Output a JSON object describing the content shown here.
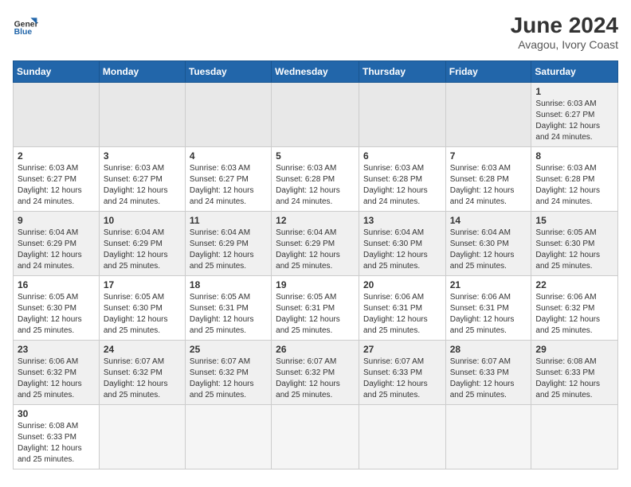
{
  "header": {
    "logo_text_normal": "General",
    "logo_text_bold": "Blue",
    "main_title": "June 2024",
    "subtitle": "Avagou, Ivory Coast"
  },
  "calendar": {
    "days_of_week": [
      "Sunday",
      "Monday",
      "Tuesday",
      "Wednesday",
      "Thursday",
      "Friday",
      "Saturday"
    ],
    "weeks": [
      [
        {
          "day": "",
          "info": ""
        },
        {
          "day": "",
          "info": ""
        },
        {
          "day": "",
          "info": ""
        },
        {
          "day": "",
          "info": ""
        },
        {
          "day": "",
          "info": ""
        },
        {
          "day": "",
          "info": ""
        },
        {
          "day": "1",
          "info": "Sunrise: 6:03 AM\nSunset: 6:27 PM\nDaylight: 12 hours and 24 minutes."
        }
      ],
      [
        {
          "day": "2",
          "info": "Sunrise: 6:03 AM\nSunset: 6:27 PM\nDaylight: 12 hours and 24 minutes."
        },
        {
          "day": "3",
          "info": "Sunrise: 6:03 AM\nSunset: 6:27 PM\nDaylight: 12 hours and 24 minutes."
        },
        {
          "day": "4",
          "info": "Sunrise: 6:03 AM\nSunset: 6:27 PM\nDaylight: 12 hours and 24 minutes."
        },
        {
          "day": "5",
          "info": "Sunrise: 6:03 AM\nSunset: 6:28 PM\nDaylight: 12 hours and 24 minutes."
        },
        {
          "day": "6",
          "info": "Sunrise: 6:03 AM\nSunset: 6:28 PM\nDaylight: 12 hours and 24 minutes."
        },
        {
          "day": "7",
          "info": "Sunrise: 6:03 AM\nSunset: 6:28 PM\nDaylight: 12 hours and 24 minutes."
        },
        {
          "day": "8",
          "info": "Sunrise: 6:03 AM\nSunset: 6:28 PM\nDaylight: 12 hours and 24 minutes."
        }
      ],
      [
        {
          "day": "9",
          "info": "Sunrise: 6:04 AM\nSunset: 6:29 PM\nDaylight: 12 hours and 24 minutes."
        },
        {
          "day": "10",
          "info": "Sunrise: 6:04 AM\nSunset: 6:29 PM\nDaylight: 12 hours and 25 minutes."
        },
        {
          "day": "11",
          "info": "Sunrise: 6:04 AM\nSunset: 6:29 PM\nDaylight: 12 hours and 25 minutes."
        },
        {
          "day": "12",
          "info": "Sunrise: 6:04 AM\nSunset: 6:29 PM\nDaylight: 12 hours and 25 minutes."
        },
        {
          "day": "13",
          "info": "Sunrise: 6:04 AM\nSunset: 6:30 PM\nDaylight: 12 hours and 25 minutes."
        },
        {
          "day": "14",
          "info": "Sunrise: 6:04 AM\nSunset: 6:30 PM\nDaylight: 12 hours and 25 minutes."
        },
        {
          "day": "15",
          "info": "Sunrise: 6:05 AM\nSunset: 6:30 PM\nDaylight: 12 hours and 25 minutes."
        }
      ],
      [
        {
          "day": "16",
          "info": "Sunrise: 6:05 AM\nSunset: 6:30 PM\nDaylight: 12 hours and 25 minutes."
        },
        {
          "day": "17",
          "info": "Sunrise: 6:05 AM\nSunset: 6:30 PM\nDaylight: 12 hours and 25 minutes."
        },
        {
          "day": "18",
          "info": "Sunrise: 6:05 AM\nSunset: 6:31 PM\nDaylight: 12 hours and 25 minutes."
        },
        {
          "day": "19",
          "info": "Sunrise: 6:05 AM\nSunset: 6:31 PM\nDaylight: 12 hours and 25 minutes."
        },
        {
          "day": "20",
          "info": "Sunrise: 6:06 AM\nSunset: 6:31 PM\nDaylight: 12 hours and 25 minutes."
        },
        {
          "day": "21",
          "info": "Sunrise: 6:06 AM\nSunset: 6:31 PM\nDaylight: 12 hours and 25 minutes."
        },
        {
          "day": "22",
          "info": "Sunrise: 6:06 AM\nSunset: 6:32 PM\nDaylight: 12 hours and 25 minutes."
        }
      ],
      [
        {
          "day": "23",
          "info": "Sunrise: 6:06 AM\nSunset: 6:32 PM\nDaylight: 12 hours and 25 minutes."
        },
        {
          "day": "24",
          "info": "Sunrise: 6:07 AM\nSunset: 6:32 PM\nDaylight: 12 hours and 25 minutes."
        },
        {
          "day": "25",
          "info": "Sunrise: 6:07 AM\nSunset: 6:32 PM\nDaylight: 12 hours and 25 minutes."
        },
        {
          "day": "26",
          "info": "Sunrise: 6:07 AM\nSunset: 6:32 PM\nDaylight: 12 hours and 25 minutes."
        },
        {
          "day": "27",
          "info": "Sunrise: 6:07 AM\nSunset: 6:33 PM\nDaylight: 12 hours and 25 minutes."
        },
        {
          "day": "28",
          "info": "Sunrise: 6:07 AM\nSunset: 6:33 PM\nDaylight: 12 hours and 25 minutes."
        },
        {
          "day": "29",
          "info": "Sunrise: 6:08 AM\nSunset: 6:33 PM\nDaylight: 12 hours and 25 minutes."
        }
      ],
      [
        {
          "day": "30",
          "info": "Sunrise: 6:08 AM\nSunset: 6:33 PM\nDaylight: 12 hours and 25 minutes."
        },
        {
          "day": "",
          "info": ""
        },
        {
          "day": "",
          "info": ""
        },
        {
          "day": "",
          "info": ""
        },
        {
          "day": "",
          "info": ""
        },
        {
          "day": "",
          "info": ""
        },
        {
          "day": "",
          "info": ""
        }
      ]
    ]
  }
}
